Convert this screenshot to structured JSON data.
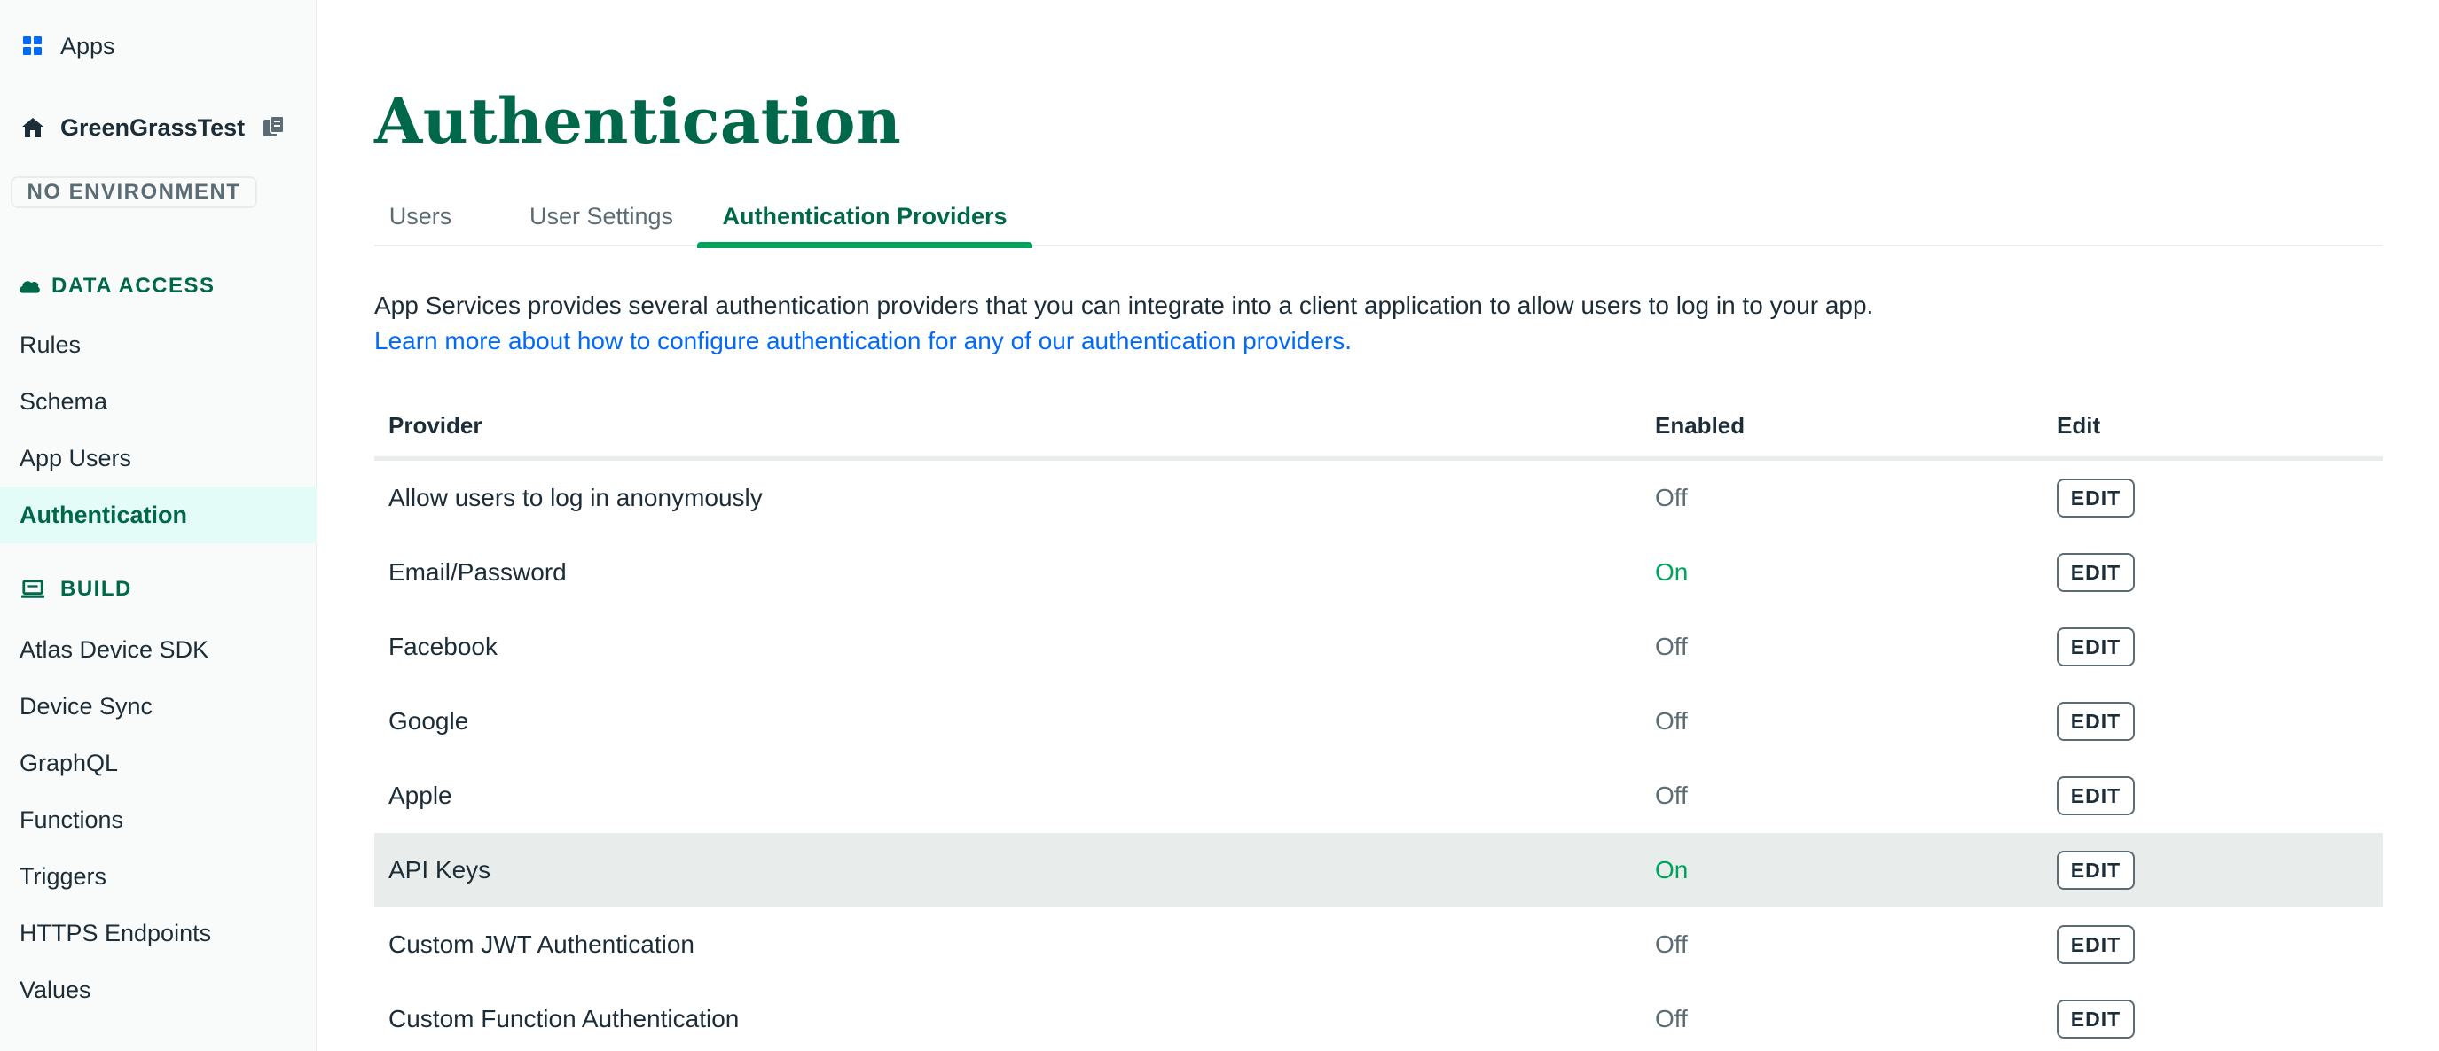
{
  "sidebar": {
    "apps_label": "Apps",
    "app_name": "GreenGrassTest",
    "environment": "NO ENVIRONMENT",
    "data_access_title": "DATA ACCESS",
    "data_access_items": [
      "Rules",
      "Schema",
      "App Users",
      "Authentication"
    ],
    "active_item": "Authentication",
    "build_title": "BUILD",
    "build_items": [
      "Atlas Device SDK",
      "Device Sync",
      "GraphQL",
      "Functions",
      "Triggers",
      "HTTPS Endpoints",
      "Values"
    ]
  },
  "page": {
    "title": "Authentication",
    "tabs": [
      "Users",
      "User Settings",
      "Authentication Providers"
    ],
    "active_tab": "Authentication Providers",
    "description": "App Services provides several authentication providers that you can integrate into a client application to allow users to log in to your app.",
    "learn_more": "Learn more about how to configure authentication for any of our authentication providers."
  },
  "table": {
    "columns": [
      "Provider",
      "Enabled",
      "Edit"
    ],
    "edit_label": "EDIT",
    "rows": [
      {
        "provider": "Allow users to log in anonymously",
        "enabled": "Off"
      },
      {
        "provider": "Email/Password",
        "enabled": "On"
      },
      {
        "provider": "Facebook",
        "enabled": "Off"
      },
      {
        "provider": "Google",
        "enabled": "Off"
      },
      {
        "provider": "Apple",
        "enabled": "Off"
      },
      {
        "provider": "API Keys",
        "enabled": "On"
      },
      {
        "provider": "Custom JWT Authentication",
        "enabled": "Off"
      },
      {
        "provider": "Custom Function Authentication",
        "enabled": "Off"
      }
    ],
    "highlighted_row": "API Keys"
  },
  "colors": {
    "brand_green": "#00684a",
    "accent_green": "#00a35c",
    "link_blue": "#016bf8",
    "apps_icon_blue": "#016bf8"
  },
  "icons": {
    "apps": "grid-icon",
    "app_home": "home-icon",
    "copy": "copy-icon",
    "data_access": "cloud-database-icon",
    "build": "laptop-icon"
  }
}
